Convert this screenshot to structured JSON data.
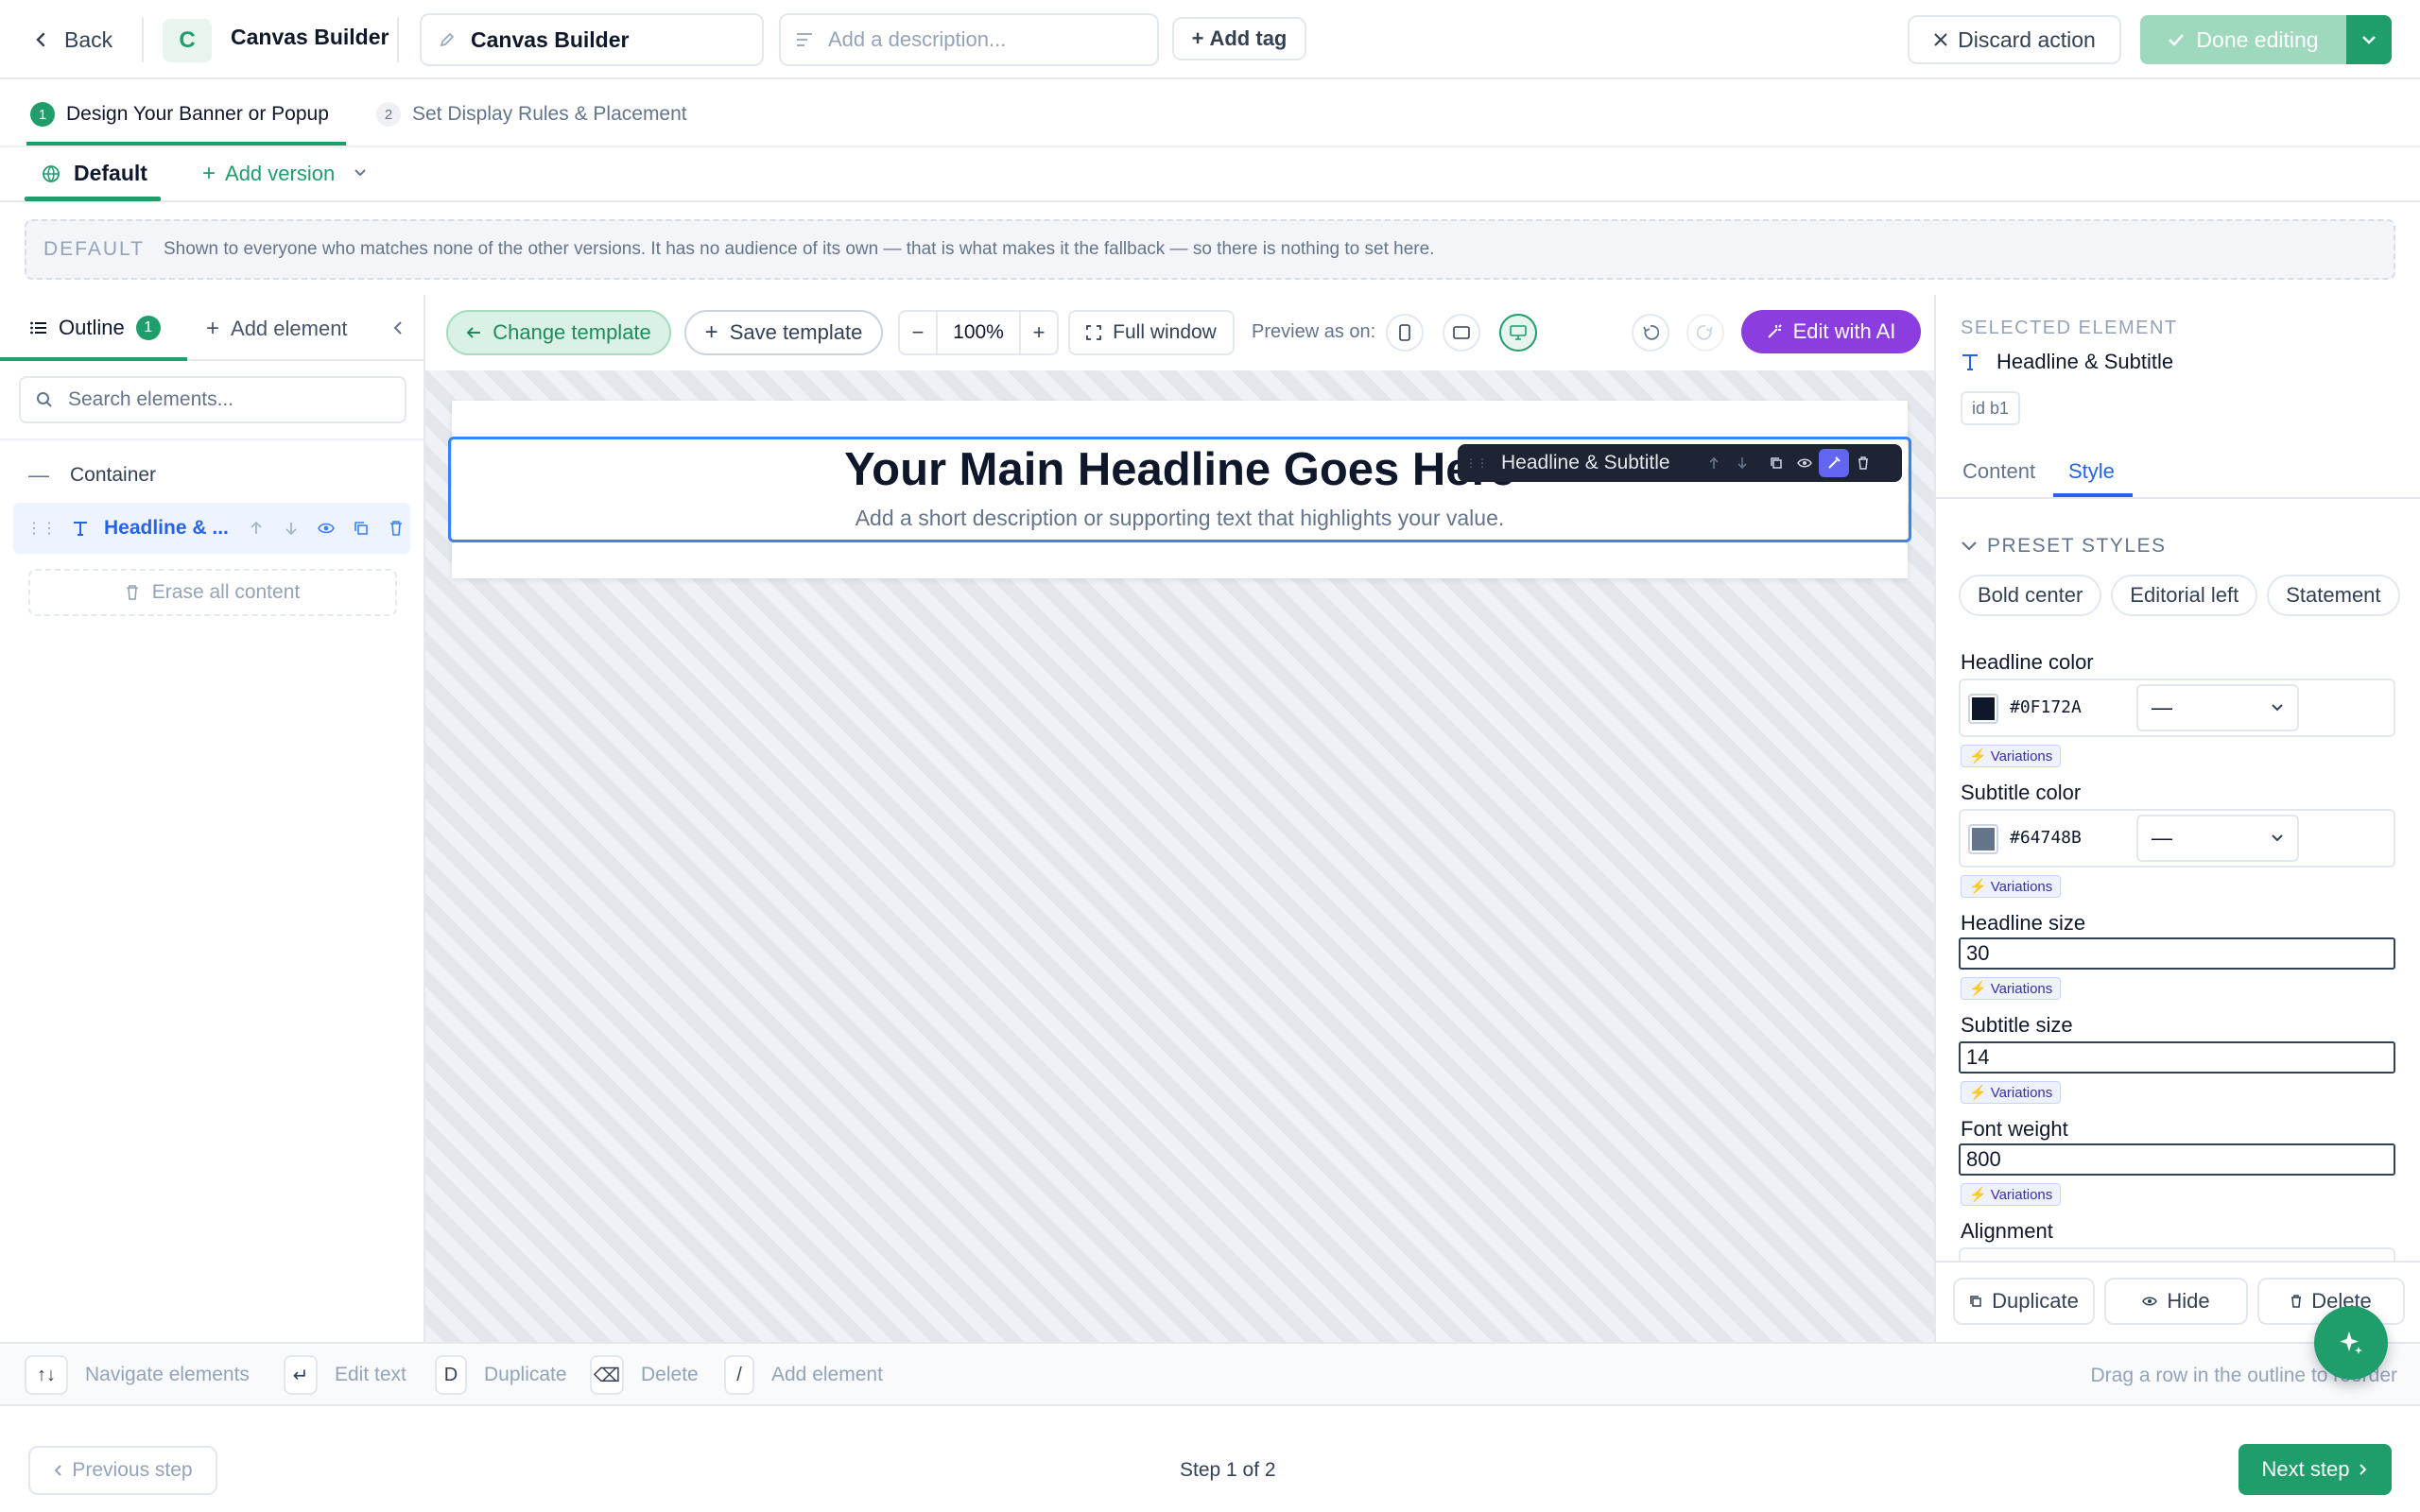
{
  "topbar": {
    "back_label": "Back",
    "app_initial": "C",
    "app_name": "Canvas Builder",
    "title_value": "Canvas Builder",
    "description_placeholder": "Add a description...",
    "add_tag_label": "Add tag",
    "discard_label": "Discard action",
    "done_label": "Done editing"
  },
  "steps": [
    {
      "num": "1",
      "label": "Design Your Banner or Popup"
    },
    {
      "num": "2",
      "label": "Set Display Rules & Placement"
    }
  ],
  "versions": {
    "default_label": "Default",
    "add_version_label": "Add version"
  },
  "banner": {
    "tag": "DEFAULT",
    "text": "Shown to everyone who matches none of the other versions. It has no audience of its own — that is what makes it the fallback — so there is nothing to set here."
  },
  "left": {
    "outline_tab": "Outline",
    "outline_count": "1",
    "add_element_tab": "Add element",
    "search_placeholder": "Search elements...",
    "container_label": "Container",
    "item_label": "Headline & ...",
    "erase_label": "Erase all content"
  },
  "toolbar": {
    "change_template": "Change template",
    "save_template": "Save template",
    "zoom_minus": "−",
    "zoom": "100%",
    "zoom_plus": "+",
    "full_window": "Full window",
    "preview_as": "Preview as on:",
    "edit_ai": "Edit with AI"
  },
  "canvas": {
    "headline": "Your Main Headline Goes Here",
    "subtitle": "Add a short description or supporting text that highlights your value.",
    "floating_label": "Headline & Subtitle"
  },
  "right": {
    "selected_heading": "SELECTED ELEMENT",
    "element_name": "Headline & Subtitle",
    "element_id": "id b1",
    "tab_content": "Content",
    "tab_style": "Style",
    "preset_heading": "PRESET STYLES",
    "presets": [
      "Bold center",
      "Editorial left",
      "Statement"
    ],
    "headline_color_label": "Headline color",
    "headline_color_value": "#0F172A",
    "subtitle_color_label": "Subtitle color",
    "subtitle_color_value": "#64748B",
    "dash": "—",
    "variations": "Variations",
    "headline_size_label": "Headline size",
    "headline_size": "30",
    "subtitle_size_label": "Subtitle size",
    "subtitle_size": "14",
    "font_weight_label": "Font weight",
    "font_weight": "800",
    "alignment_label": "Alignment",
    "duplicate": "Duplicate",
    "hide": "Hide",
    "delete": "Delete"
  },
  "shortcuts": {
    "items": [
      {
        "key": "↑↓",
        "label": "Navigate elements"
      },
      {
        "key": "↵",
        "label": "Edit text"
      },
      {
        "key": "D",
        "label": "Duplicate"
      },
      {
        "key": "⌫",
        "label": "Delete"
      },
      {
        "key": "/",
        "label": "Add element"
      }
    ],
    "hint": "Drag a row in the outline to reorder"
  },
  "footer": {
    "prev": "Previous step",
    "step": "Step 1 of 2",
    "next": "Next step"
  },
  "colors": {
    "accent": "#1f9d6b",
    "ai_purple": "#8b3ddf",
    "selection_blue": "#3b82f6"
  }
}
